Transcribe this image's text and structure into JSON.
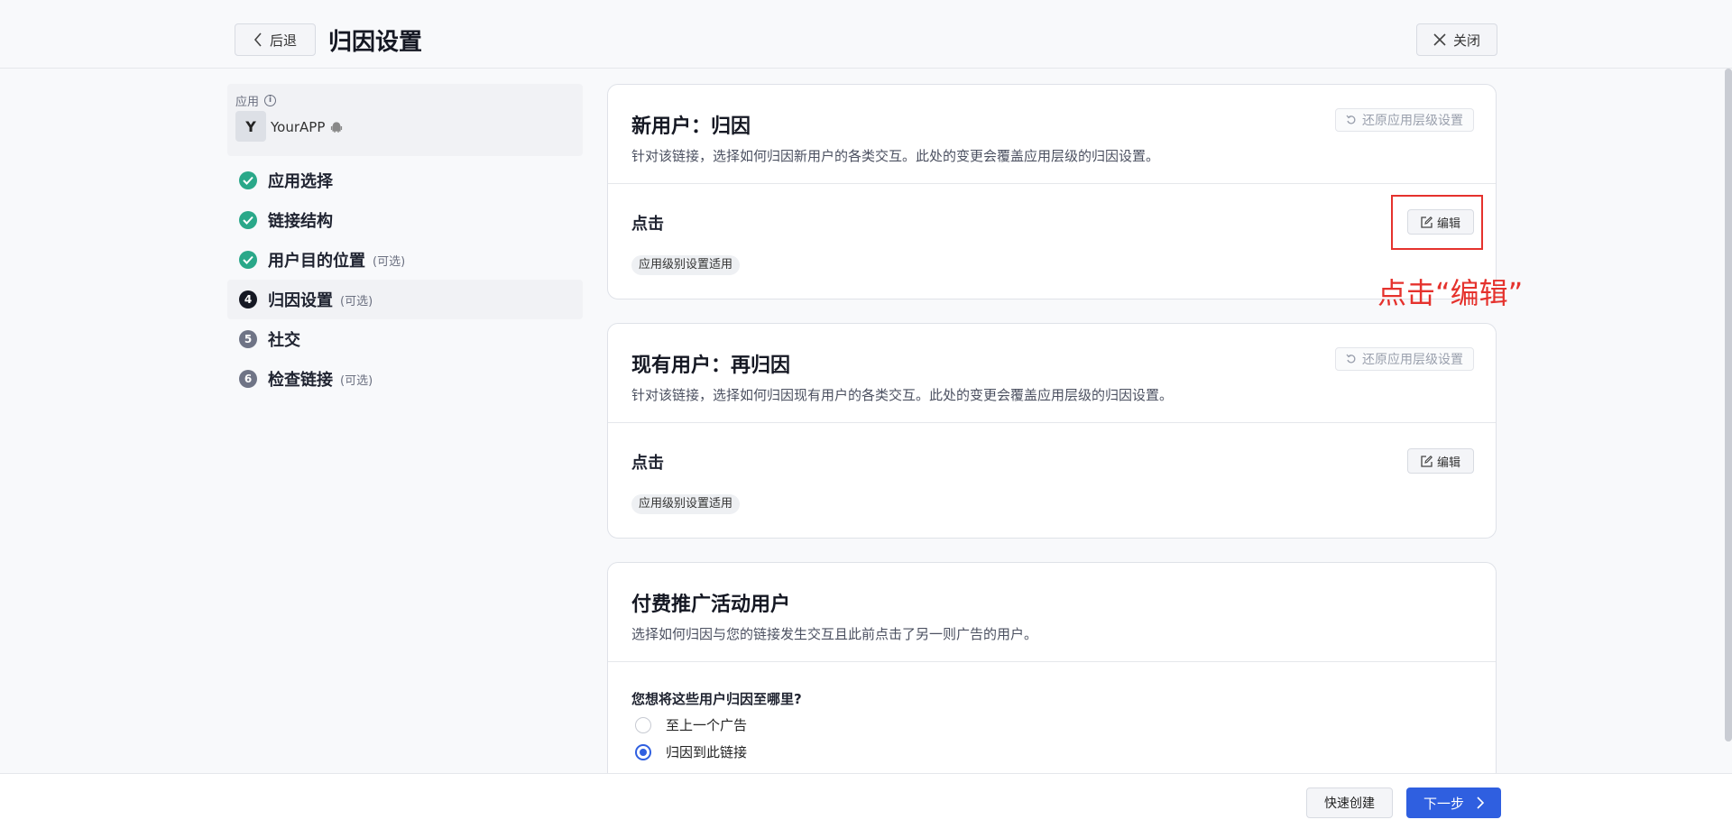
{
  "header": {
    "back_label": "后退",
    "title": "归因设置",
    "close_label": "关闭"
  },
  "sidebar": {
    "app_label": "应用",
    "app_avatar": "Y",
    "app_name": "YourAPP",
    "steps": [
      {
        "label": "应用选择",
        "optional": "",
        "state": "done"
      },
      {
        "label": "链接结构",
        "optional": "",
        "state": "done"
      },
      {
        "label": "用户目的位置",
        "optional": "(可选)",
        "state": "done"
      },
      {
        "label": "归因设置",
        "optional": "(可选)",
        "state": "current",
        "num": "4"
      },
      {
        "label": "社交",
        "optional": "",
        "state": "todo",
        "num": "5"
      },
      {
        "label": "检查链接",
        "optional": "(可选)",
        "state": "todo",
        "num": "6"
      }
    ]
  },
  "cards": {
    "new_users": {
      "title": "新用户：归因",
      "desc": "针对该链接，选择如何归因新用户的各类交互。此处的变更会覆盖应用层级的归因设置。",
      "reset_label": "还原应用层级设置",
      "section_label": "点击",
      "edit_label": "编辑",
      "tag": "应用级别设置适用"
    },
    "existing_users": {
      "title": "现有用户：再归因",
      "desc": "针对该链接，选择如何归因现有用户的各类交互。此处的变更会覆盖应用层级的归因设置。",
      "reset_label": "还原应用层级设置",
      "section_label": "点击",
      "edit_label": "编辑",
      "tag": "应用级别设置适用"
    },
    "paid_users": {
      "title": "付费推广活动用户",
      "desc": "选择如何归因与您的链接发生交互且此前点击了另一则广告的用户。",
      "question": "您想将这些用户归因至哪里?",
      "options": [
        {
          "label": "至上一个广告",
          "selected": false
        },
        {
          "label": "归因到此链接",
          "selected": true
        }
      ]
    }
  },
  "annotation": {
    "text": "点击“编辑”",
    "color": "#e5322d"
  },
  "footer": {
    "quick_label": "快速创建",
    "next_label": "下一步"
  },
  "colors": {
    "accent": "#2f5fe0",
    "done": "#2aa889"
  }
}
